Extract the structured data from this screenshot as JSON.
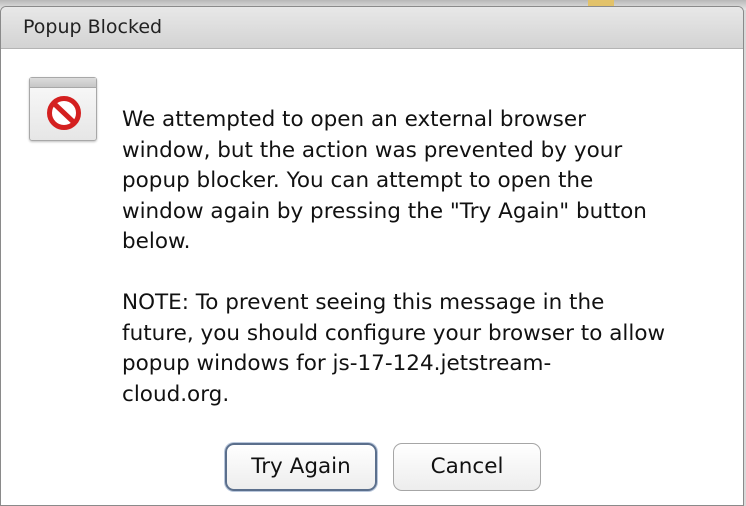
{
  "dialog": {
    "title": "Popup Blocked",
    "icon": "popup-blocked-window-icon",
    "message": {
      "paragraph1_lines": [
        "We attempted to open an external browser",
        "window, but the action was prevented by your",
        "popup blocker. You can attempt to open the",
        "window again by pressing the \"Try Again\" button",
        "below."
      ],
      "paragraph2_lines": [
        "NOTE: To prevent seeing this message in the",
        "future, you should configure your browser to allow",
        "popup windows for js-17-124.jetstream-",
        "cloud.org."
      ]
    },
    "buttons": {
      "try_again": "Try Again",
      "cancel": "Cancel"
    }
  },
  "colors": {
    "block_icon_red": "#d42020",
    "dialog_background": "#ffffff",
    "titlebar_background": "#dddddd",
    "default_button_border": "#5b6f8c"
  }
}
